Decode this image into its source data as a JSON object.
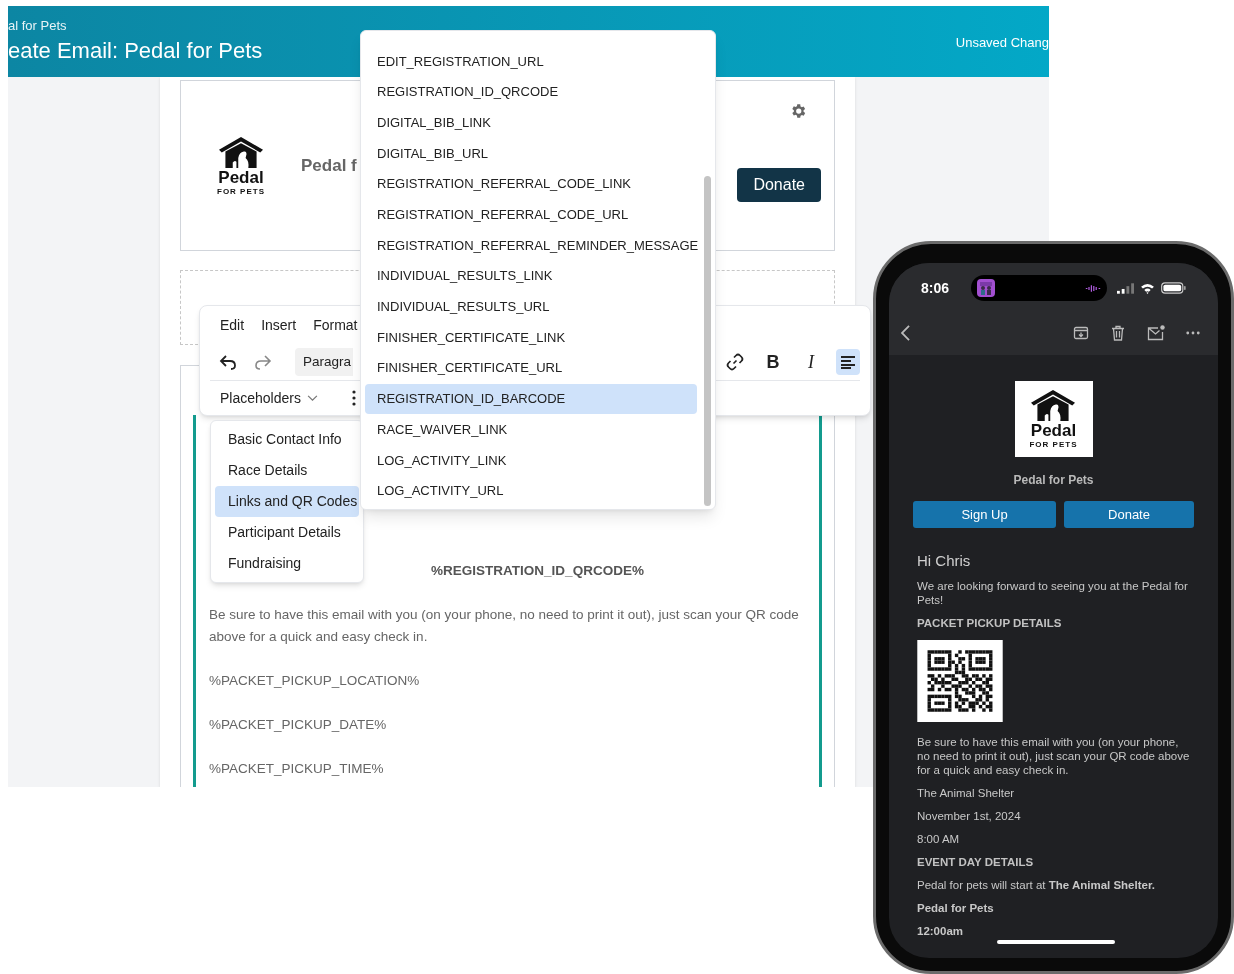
{
  "header": {
    "breadcrumb": "al for Pets",
    "title": "eate Email: Pedal for Pets",
    "status": "Unsaved Chang"
  },
  "email_header": {
    "logo": {
      "name": "Pedal",
      "tagline": "FOR PETS"
    },
    "title": "Pedal f",
    "buttons": [
      "Donate"
    ]
  },
  "editor": {
    "menus": [
      "Edit",
      "Insert",
      "Format"
    ],
    "block_format": "Paragra",
    "formatting": [
      {
        "kind": "link",
        "selected": false
      },
      {
        "kind": "bold",
        "label": "B",
        "selected": false
      },
      {
        "kind": "italic",
        "label": "I",
        "selected": false
      },
      {
        "kind": "align",
        "selected": true
      }
    ],
    "placeholders_button": "Placeholders",
    "content": [
      {
        "kind": "code",
        "text": "%REGISTRATION_ID_QRCODE%"
      },
      {
        "kind": "paragraph",
        "text": "Be sure to have this email with you (on your phone, no need to print it out), just scan your QR code above for a quick and easy check in."
      },
      {
        "kind": "paragraph",
        "text": "%PACKET_PICKUP_LOCATION%"
      },
      {
        "kind": "paragraph",
        "text": "%PACKET_PICKUP_DATE%"
      },
      {
        "kind": "paragraph",
        "text": "%PACKET_PICKUP_TIME%"
      }
    ]
  },
  "placeholder_menu": [
    {
      "label": "Basic Contact Info",
      "selected": false
    },
    {
      "label": "Race Details",
      "selected": false
    },
    {
      "label": "Links and QR Codes",
      "selected": true
    },
    {
      "label": "Participant Details",
      "selected": false
    },
    {
      "label": "Fundraising",
      "selected": false
    }
  ],
  "placeholder_list": [
    {
      "label": "EDIT_REGISTRATION_URL",
      "selected": false
    },
    {
      "label": "REGISTRATION_ID_QRCODE",
      "selected": false
    },
    {
      "label": "DIGITAL_BIB_LINK",
      "selected": false
    },
    {
      "label": "DIGITAL_BIB_URL",
      "selected": false
    },
    {
      "label": "REGISTRATION_REFERRAL_CODE_LINK",
      "selected": false
    },
    {
      "label": "REGISTRATION_REFERRAL_CODE_URL",
      "selected": false
    },
    {
      "label": "REGISTRATION_REFERRAL_REMINDER_MESSAGE",
      "selected": false
    },
    {
      "label": "INDIVIDUAL_RESULTS_LINK",
      "selected": false
    },
    {
      "label": "INDIVIDUAL_RESULTS_URL",
      "selected": false
    },
    {
      "label": "FINISHER_CERTIFICATE_LINK",
      "selected": false
    },
    {
      "label": "FINISHER_CERTIFICATE_URL",
      "selected": false
    },
    {
      "label": "REGISTRATION_ID_BARCODE",
      "selected": true
    },
    {
      "label": "RACE_WAIVER_LINK",
      "selected": false
    },
    {
      "label": "LOG_ACTIVITY_LINK",
      "selected": false
    },
    {
      "label": "LOG_ACTIVITY_URL",
      "selected": false
    }
  ],
  "phone": {
    "time": "8:06",
    "email": {
      "logo": {
        "name": "Pedal",
        "tagline": "FOR PETS"
      },
      "org_name": "Pedal for Pets",
      "buttons": [
        "Sign Up",
        "Donate"
      ],
      "blocks": [
        {
          "kind": "greeting",
          "text": "Hi Chris"
        },
        {
          "kind": "paragraph",
          "text": "We are looking forward to seeing you at the Pedal for Pets!"
        },
        {
          "kind": "heading",
          "text": "PACKET PICKUP DETAILS"
        },
        {
          "kind": "qr"
        },
        {
          "kind": "paragraph",
          "text": "Be sure to have this email with you (on your phone, no need to print it out), just scan your QR code above for a quick and easy check in."
        },
        {
          "kind": "paragraph",
          "text": "The Animal Shelter"
        },
        {
          "kind": "paragraph",
          "text": "November 1st, 2024"
        },
        {
          "kind": "paragraph",
          "text": "8:00 AM"
        },
        {
          "kind": "heading",
          "text": "EVENT DAY DETAILS"
        },
        {
          "kind": "paragraph",
          "text": "Pedal for pets will start at **The Animal Shelter.**"
        },
        {
          "kind": "strong",
          "text": "Pedal for Pets"
        },
        {
          "kind": "strong",
          "text": "12:00am"
        }
      ]
    }
  }
}
